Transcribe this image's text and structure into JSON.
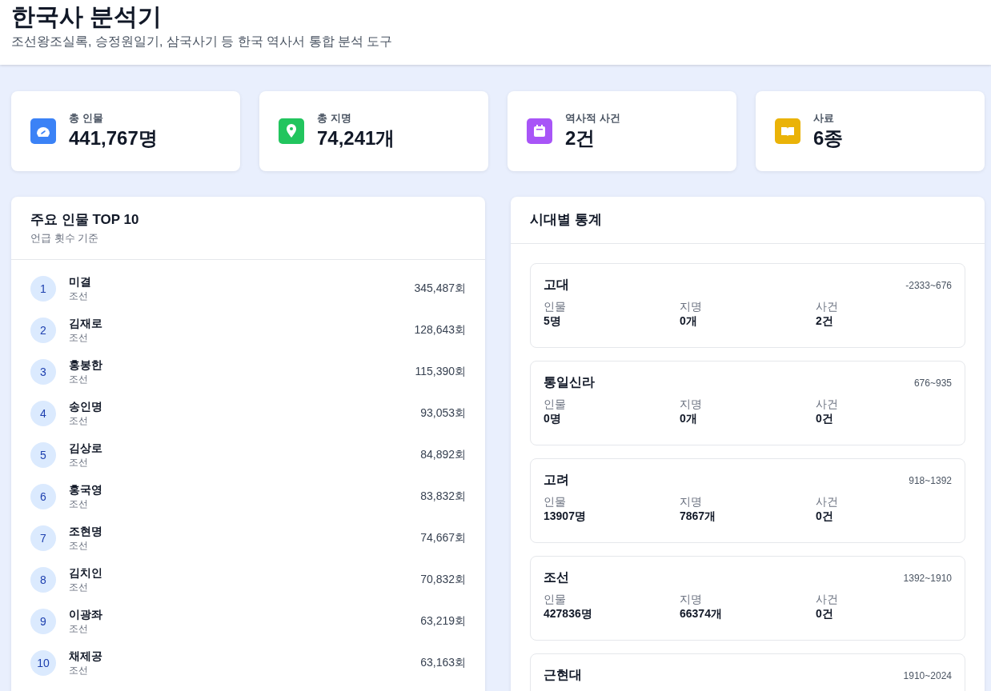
{
  "header": {
    "title": "한국사 분석기",
    "subtitle": "조선왕조실록, 승정원일기, 삼국사기 등 한국 역사서 통합 분석 도구"
  },
  "stats": [
    {
      "kind": "person",
      "color": "#3b82f6",
      "label": "총 인물",
      "value": "441,767명"
    },
    {
      "kind": "pin",
      "color": "#22c55e",
      "label": "총 지명",
      "value": "74,241개"
    },
    {
      "kind": "calendar",
      "color": "#a855f7",
      "label": "역사적 사건",
      "value": "2건"
    },
    {
      "kind": "book",
      "color": "#eab308",
      "label": "사료",
      "value": "6종"
    }
  ],
  "top_people": {
    "title": "주요 인물 TOP 10",
    "subtitle": "언급 횟수 기준",
    "rows": [
      {
        "rank": "1",
        "name": "미결",
        "era": "조선",
        "count": "345,487회"
      },
      {
        "rank": "2",
        "name": "김재로",
        "era": "조선",
        "count": "128,643회"
      },
      {
        "rank": "3",
        "name": "홍봉한",
        "era": "조선",
        "count": "115,390회"
      },
      {
        "rank": "4",
        "name": "송인명",
        "era": "조선",
        "count": "93,053회"
      },
      {
        "rank": "5",
        "name": "김상로",
        "era": "조선",
        "count": "84,892회"
      },
      {
        "rank": "6",
        "name": "홍국영",
        "era": "조선",
        "count": "83,832회"
      },
      {
        "rank": "7",
        "name": "조현명",
        "era": "조선",
        "count": "74,667회"
      },
      {
        "rank": "8",
        "name": "김치인",
        "era": "조선",
        "count": "70,832회"
      },
      {
        "rank": "9",
        "name": "이광좌",
        "era": "조선",
        "count": "63,219회"
      },
      {
        "rank": "10",
        "name": "채제공",
        "era": "조선",
        "count": "63,163회"
      }
    ]
  },
  "period_stats": {
    "title": "시대별 통계",
    "periods": [
      {
        "name": "고대",
        "range": "-2333~676",
        "metrics": [
          {
            "label": "인물",
            "value": "5명"
          },
          {
            "label": "지명",
            "value": "0개"
          },
          {
            "label": "사건",
            "value": "2건"
          }
        ]
      },
      {
        "name": "통일신라",
        "range": "676~935",
        "metrics": [
          {
            "label": "인물",
            "value": "0명"
          },
          {
            "label": "지명",
            "value": "0개"
          },
          {
            "label": "사건",
            "value": "0건"
          }
        ]
      },
      {
        "name": "고려",
        "range": "918~1392",
        "metrics": [
          {
            "label": "인물",
            "value": "13907명"
          },
          {
            "label": "지명",
            "value": "7867개"
          },
          {
            "label": "사건",
            "value": "0건"
          }
        ]
      },
      {
        "name": "조선",
        "range": "1392~1910",
        "metrics": [
          {
            "label": "인물",
            "value": "427836명"
          },
          {
            "label": "지명",
            "value": "66374개"
          },
          {
            "label": "사건",
            "value": "0건"
          }
        ]
      },
      {
        "name": "근현대",
        "range": "1910~2024"
      }
    ]
  }
}
